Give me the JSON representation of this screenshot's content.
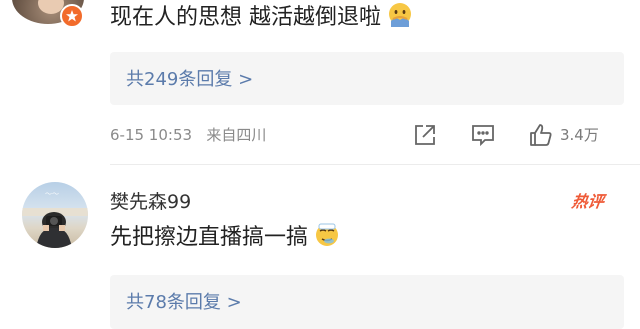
{
  "comments": [
    {
      "text": "现在人的思想 越活越倒退啦",
      "emoji": "face-with-hand-over-mouth-emoji",
      "replies_label": "共249条回复 >",
      "date": "6-15 10:53",
      "location": "来自四川",
      "likes": "3.4万"
    },
    {
      "username": "樊先森99",
      "badge": "热评",
      "text": "先把擦边直播搞一搞",
      "emoji": "sick-face-emoji",
      "replies_label": "共78条回复 >"
    }
  ],
  "colors": {
    "link": "#5b7bab",
    "meta": "#8a8a8a",
    "badge": "#ef5a37",
    "reply_bg": "#f5f5f5"
  }
}
